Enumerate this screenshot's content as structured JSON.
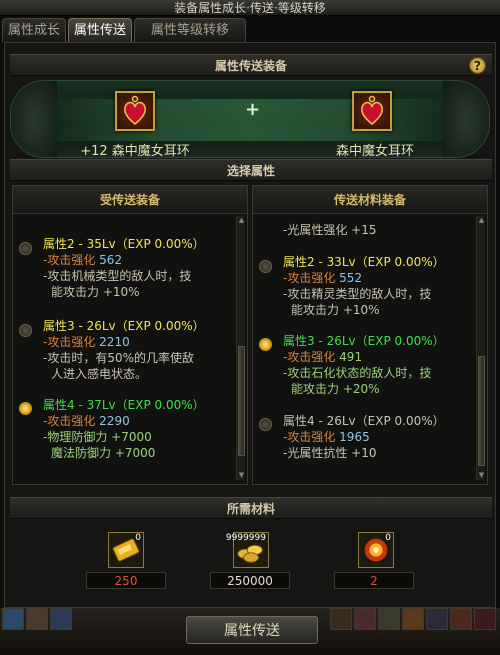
{
  "window": {
    "title": "装备属性成长·传送·等级转移"
  },
  "tabs": [
    {
      "label": "属性成长",
      "active": false
    },
    {
      "label": "属性传送",
      "active": true
    },
    {
      "label": "属性等级转移",
      "active": false
    }
  ],
  "transfer_equipment": {
    "header": "属性传送装备",
    "help": "?",
    "source_item": {
      "name": "+12 森中魔女耳环",
      "icon": "heart-earring-icon"
    },
    "plus_sign": "+",
    "target_item": {
      "name": "森中魔女耳环",
      "icon": "heart-earring-icon"
    }
  },
  "select_attribute": {
    "header": "选择属性",
    "left_panel": {
      "title": "受传送装备",
      "entries": [
        {
          "selected": false,
          "title": "属性2 - 35Lv（EXP 0.00%）",
          "lines": [
            {
              "label": "-攻击强化",
              "value": "562"
            },
            {
              "text": "-攻击机械类型的敌人时，技"
            },
            {
              "text": "能攻击力 +10%"
            }
          ]
        },
        {
          "selected": false,
          "title": "属性3 - 26Lv（EXP 0.00%）",
          "lines": [
            {
              "label": "-攻击强化",
              "value": "2210"
            },
            {
              "text": "-攻击时，有50%的几率使敌"
            },
            {
              "text": "人进入感电状态。"
            }
          ]
        },
        {
          "selected": true,
          "title": "属性4 - 37Lv（EXP 0.00%）",
          "lines": [
            {
              "label": "-攻击强化",
              "value": "2290"
            },
            {
              "text": "-物理防御力 +7000"
            },
            {
              "text": "魔法防御力 +7000"
            }
          ]
        }
      ]
    },
    "right_panel": {
      "title": "传送材料装备",
      "top_line": "-光属性强化 +15",
      "entries": [
        {
          "selected": false,
          "title": "属性2 - 33Lv（EXP 0.00%）",
          "lines": [
            {
              "label": "-攻击强化",
              "value": "552"
            },
            {
              "text": "-攻击精灵类型的敌人时，技"
            },
            {
              "text": "能攻击力 +10%"
            }
          ]
        },
        {
          "selected": true,
          "title": "属性3 - 26Lv（EXP 0.00%）",
          "lines": [
            {
              "label": "-攻击强化",
              "value": "491"
            },
            {
              "text": "-攻击石化状态的敌人时，技"
            },
            {
              "text": "能攻击力 +20%"
            }
          ]
        },
        {
          "selected": false,
          "title": "属性4 - 26Lv（EXP 0.00%）",
          "lines": [
            {
              "label": "-攻击强化",
              "value": "1965"
            },
            {
              "text": "-光属性抗性 +10"
            }
          ]
        }
      ]
    }
  },
  "materials": {
    "header": "所需材料",
    "items": [
      {
        "icon": "gold-ticket-icon",
        "count": "0",
        "required": "250",
        "color": "#e84a3a"
      },
      {
        "icon": "gold-coins-icon",
        "count": "9999999",
        "required": "250000",
        "color": "#e3dccb"
      },
      {
        "icon": "fire-orb-icon",
        "count": "0",
        "required": "2",
        "color": "#e84a3a"
      }
    ]
  },
  "submit": {
    "label": "属性传送"
  }
}
